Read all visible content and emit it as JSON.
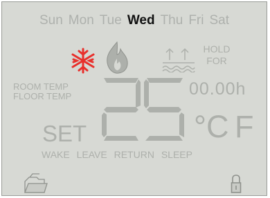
{
  "days": [
    {
      "label": "Sun",
      "active": false
    },
    {
      "label": "Mon",
      "active": false
    },
    {
      "label": "Tue",
      "active": false
    },
    {
      "label": "Wed",
      "active": true
    },
    {
      "label": "Thu",
      "active": false
    },
    {
      "label": "Fri",
      "active": false
    },
    {
      "label": "Sat",
      "active": false
    }
  ],
  "hold": {
    "line1": "HOLD",
    "line2": "FOR"
  },
  "sensor": {
    "room": "ROOM TEMP",
    "floor": "FLOOR TEMP"
  },
  "timer": "00.00h",
  "temperature": "25",
  "units": {
    "celsius": "°C",
    "fahrenheit": "F"
  },
  "set_label": "SET",
  "modes": [
    "WAKE",
    "LEAVE",
    "RETURN",
    "SLEEP"
  ],
  "icons": {
    "snow": "snowflake-icon",
    "flame": "flame-icon",
    "heat": "floor-heating-icon",
    "folder": "folder-icon",
    "lock": "lock-icon"
  },
  "colors": {
    "screen": "#d7d9d4",
    "active_text": "#111111",
    "segment": "#adb0ab",
    "snow": "#e8302c"
  }
}
